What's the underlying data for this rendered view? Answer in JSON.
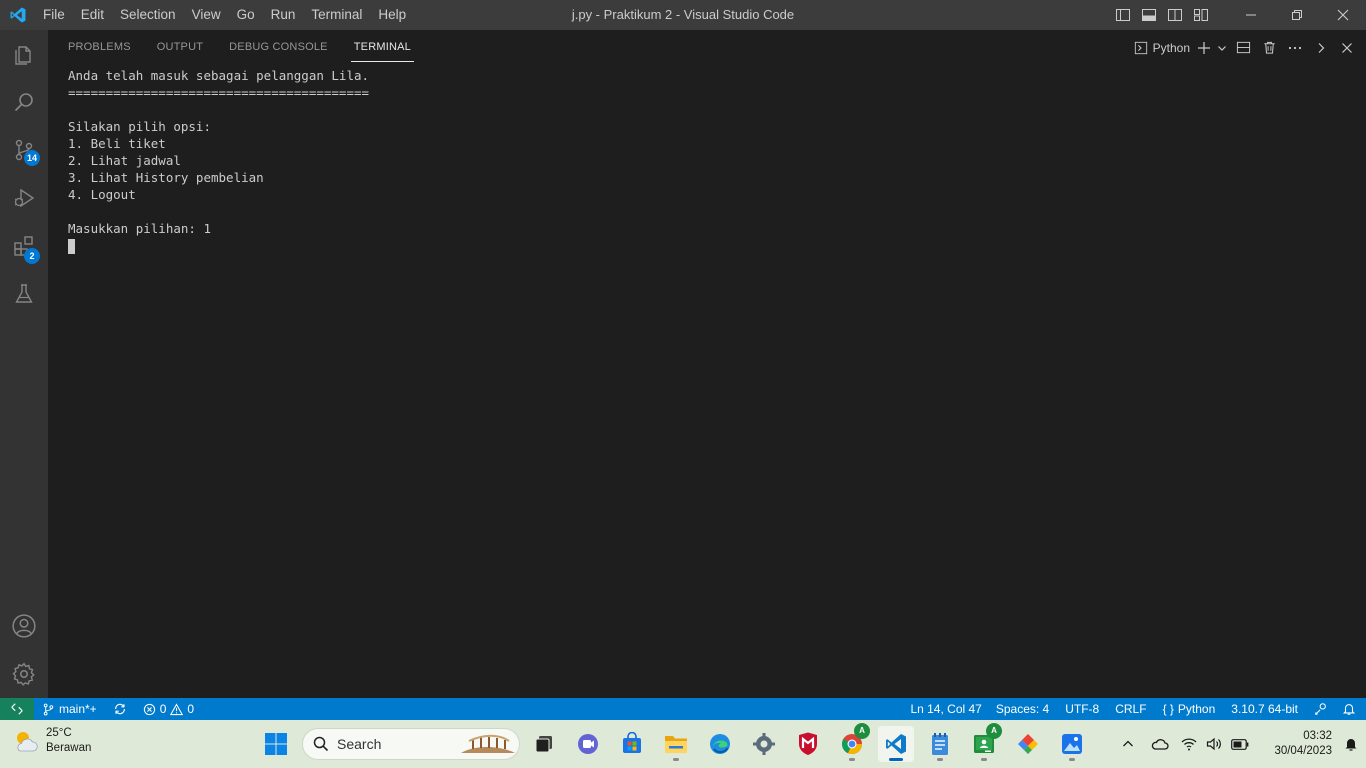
{
  "titlebar": {
    "menus": [
      "File",
      "Edit",
      "Selection",
      "View",
      "Go",
      "Run",
      "Terminal",
      "Help"
    ],
    "window_title": "j.py - Praktikum 2 - Visual Studio Code"
  },
  "activitybar": {
    "source_control_badge": "14",
    "extensions_badge": "2"
  },
  "panel": {
    "tabs": [
      "PROBLEMS",
      "OUTPUT",
      "DEBUG CONSOLE",
      "TERMINAL"
    ],
    "active_tab": "TERMINAL",
    "terminal_profile": "Python"
  },
  "terminal": {
    "lines": [
      "Anda telah masuk sebagai pelanggan Lila.",
      "========================================",
      "",
      "Silakan pilih opsi:",
      "1. Beli tiket",
      "2. Lihat jadwal",
      "3. Lihat History pembelian",
      "4. Logout",
      "",
      "Masukkan pilihan: 1"
    ]
  },
  "statusbar": {
    "branch": "main*+",
    "errors": "0",
    "warnings": "0",
    "cursor_position": "Ln 14, Col 47",
    "indentation": "Spaces: 4",
    "encoding": "UTF-8",
    "eol": "CRLF",
    "language": "Python",
    "interpreter": "3.10.7 64-bit"
  },
  "taskbar": {
    "weather_temp": "25°C",
    "weather_desc": "Berawan",
    "search_placeholder": "Search",
    "time": "03:32",
    "date": "30/04/2023"
  },
  "colors": {
    "titlebar_bg": "#3c3c3c",
    "activitybar_bg": "#333333",
    "editor_bg": "#1e1e1e",
    "statusbar_bg": "#007acc",
    "remote_bg": "#16825d",
    "badge_bg": "#0078d4",
    "taskbar_bg": "#dfe9d8"
  }
}
